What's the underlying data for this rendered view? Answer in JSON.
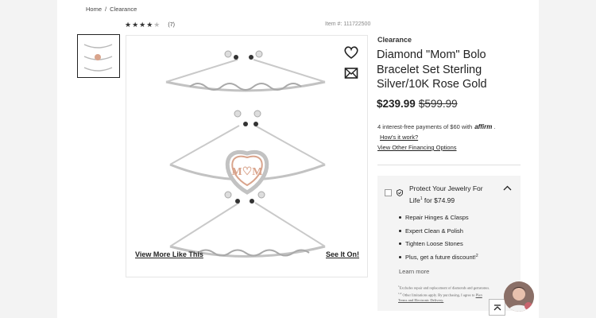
{
  "breadcrumb": {
    "home": "Home",
    "separator": "/",
    "current": "Clearance"
  },
  "rating": {
    "stars": "★★★★",
    "half": "★",
    "count": "(7)"
  },
  "item_number": "Item #: 111722500",
  "gallery": {
    "view_more": "View More Like This",
    "see_it_on": "See It On!"
  },
  "icons": {
    "wishlist": "heart-icon",
    "share": "mail-icon",
    "chat": "chat-avatar-icon",
    "scroll_top": "arrow-up-icon"
  },
  "product": {
    "category": "Clearance",
    "title": "Diamond \"Mom\" Bolo Bracelet Set Sterling Silver/10K Rose Gold",
    "price": "$239.99",
    "old_price": "$599.99"
  },
  "financing": {
    "text": "4 interest-free payments of $60 with",
    "provider": "affirm",
    "end": ".",
    "how_link": "How's it work?",
    "options_link": "View Other Financing Options"
  },
  "protection": {
    "title_a": "Protect Your Jewelry For Life",
    "title_sup": "1",
    "title_b": " for $74.99",
    "benefits": [
      "Repair Hinges & Clasps",
      "Expert Clean & Polish",
      "Tighten Loose Stones",
      "Plus, get a future discount!"
    ],
    "benefit_sup": "2",
    "learn_more": "Learn more",
    "fine_print_a": "Excludes repair and replacement of diamonds and gemstones.",
    "fine_print_sup": "1,2",
    "fine_print_b": " Other limitations apply. By purchasing, I agree to ",
    "fine_print_link": "Plan Terms and Electronic Delivery."
  },
  "colors": {
    "rose_gold": "#d9a48c",
    "silver": "#b9b9b9",
    "accent_text": "#222222"
  }
}
